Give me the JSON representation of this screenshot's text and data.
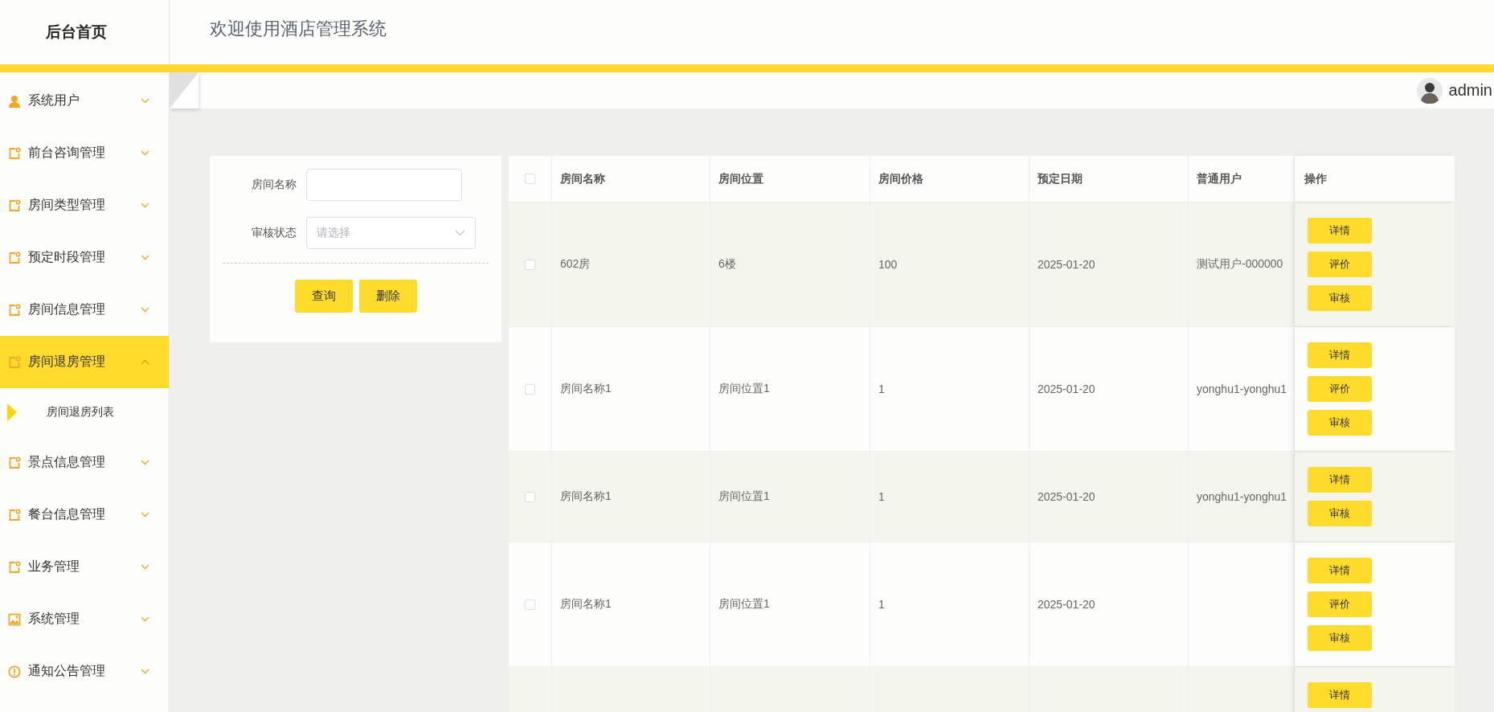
{
  "header": {
    "brand": "后台首页",
    "title": "欢迎使用酒店管理系统"
  },
  "user": {
    "name": "admin"
  },
  "sidebar": {
    "items": [
      {
        "label": "系统用户",
        "kind": "user",
        "expanded": false
      },
      {
        "label": "前台咨询管理",
        "kind": "module",
        "expanded": false
      },
      {
        "label": "房间类型管理",
        "kind": "module",
        "expanded": false
      },
      {
        "label": "预定时段管理",
        "kind": "module",
        "expanded": false
      },
      {
        "label": "房间信息管理",
        "kind": "module",
        "expanded": false
      },
      {
        "label": "房间退房管理",
        "kind": "module",
        "expanded": true,
        "children": [
          {
            "label": "房间退房列表",
            "selected": true
          }
        ]
      },
      {
        "label": "景点信息管理",
        "kind": "module",
        "expanded": false
      },
      {
        "label": "餐台信息管理",
        "kind": "module",
        "expanded": false
      },
      {
        "label": "业务管理",
        "kind": "module",
        "expanded": false
      },
      {
        "label": "系统管理",
        "kind": "image",
        "expanded": false
      },
      {
        "label": "通知公告管理",
        "kind": "notice",
        "expanded": false
      }
    ]
  },
  "search": {
    "fields": [
      {
        "label": "房间名称",
        "kind": "text"
      },
      {
        "label": "审核状态",
        "kind": "select",
        "placeholder": "请选择"
      }
    ],
    "buttons": [
      "查询",
      "删除"
    ]
  },
  "table": {
    "select_all": false,
    "columns": [
      "房间名称",
      "房间位置",
      "房间价格",
      "预定日期",
      "普通用户",
      "操作"
    ],
    "rows": [
      {
        "selected": false,
        "cells": [
          "602房",
          "6楼",
          "100",
          "2025-01-20",
          "测试用户-000000"
        ],
        "actions": [
          "详情",
          "评价",
          "审核"
        ]
      },
      {
        "selected": false,
        "cells": [
          "房间名称1",
          "房间位置1",
          "1",
          "2025-01-20",
          "yonghu1-yonghu1"
        ],
        "actions": [
          "详情",
          "评价",
          "审核"
        ]
      },
      {
        "selected": false,
        "cells": [
          "房间名称1",
          "房间位置1",
          "1",
          "2025-01-20",
          "yonghu1-yonghu1"
        ],
        "actions": [
          "详情",
          "审核"
        ]
      },
      {
        "selected": false,
        "cells": [
          "房间名称1",
          "房间位置1",
          "1",
          "2025-01-20"
        ],
        "actions": [
          "详情",
          "评价",
          "审核"
        ]
      },
      {
        "actions": [
          "详情"
        ]
      }
    ]
  }
}
